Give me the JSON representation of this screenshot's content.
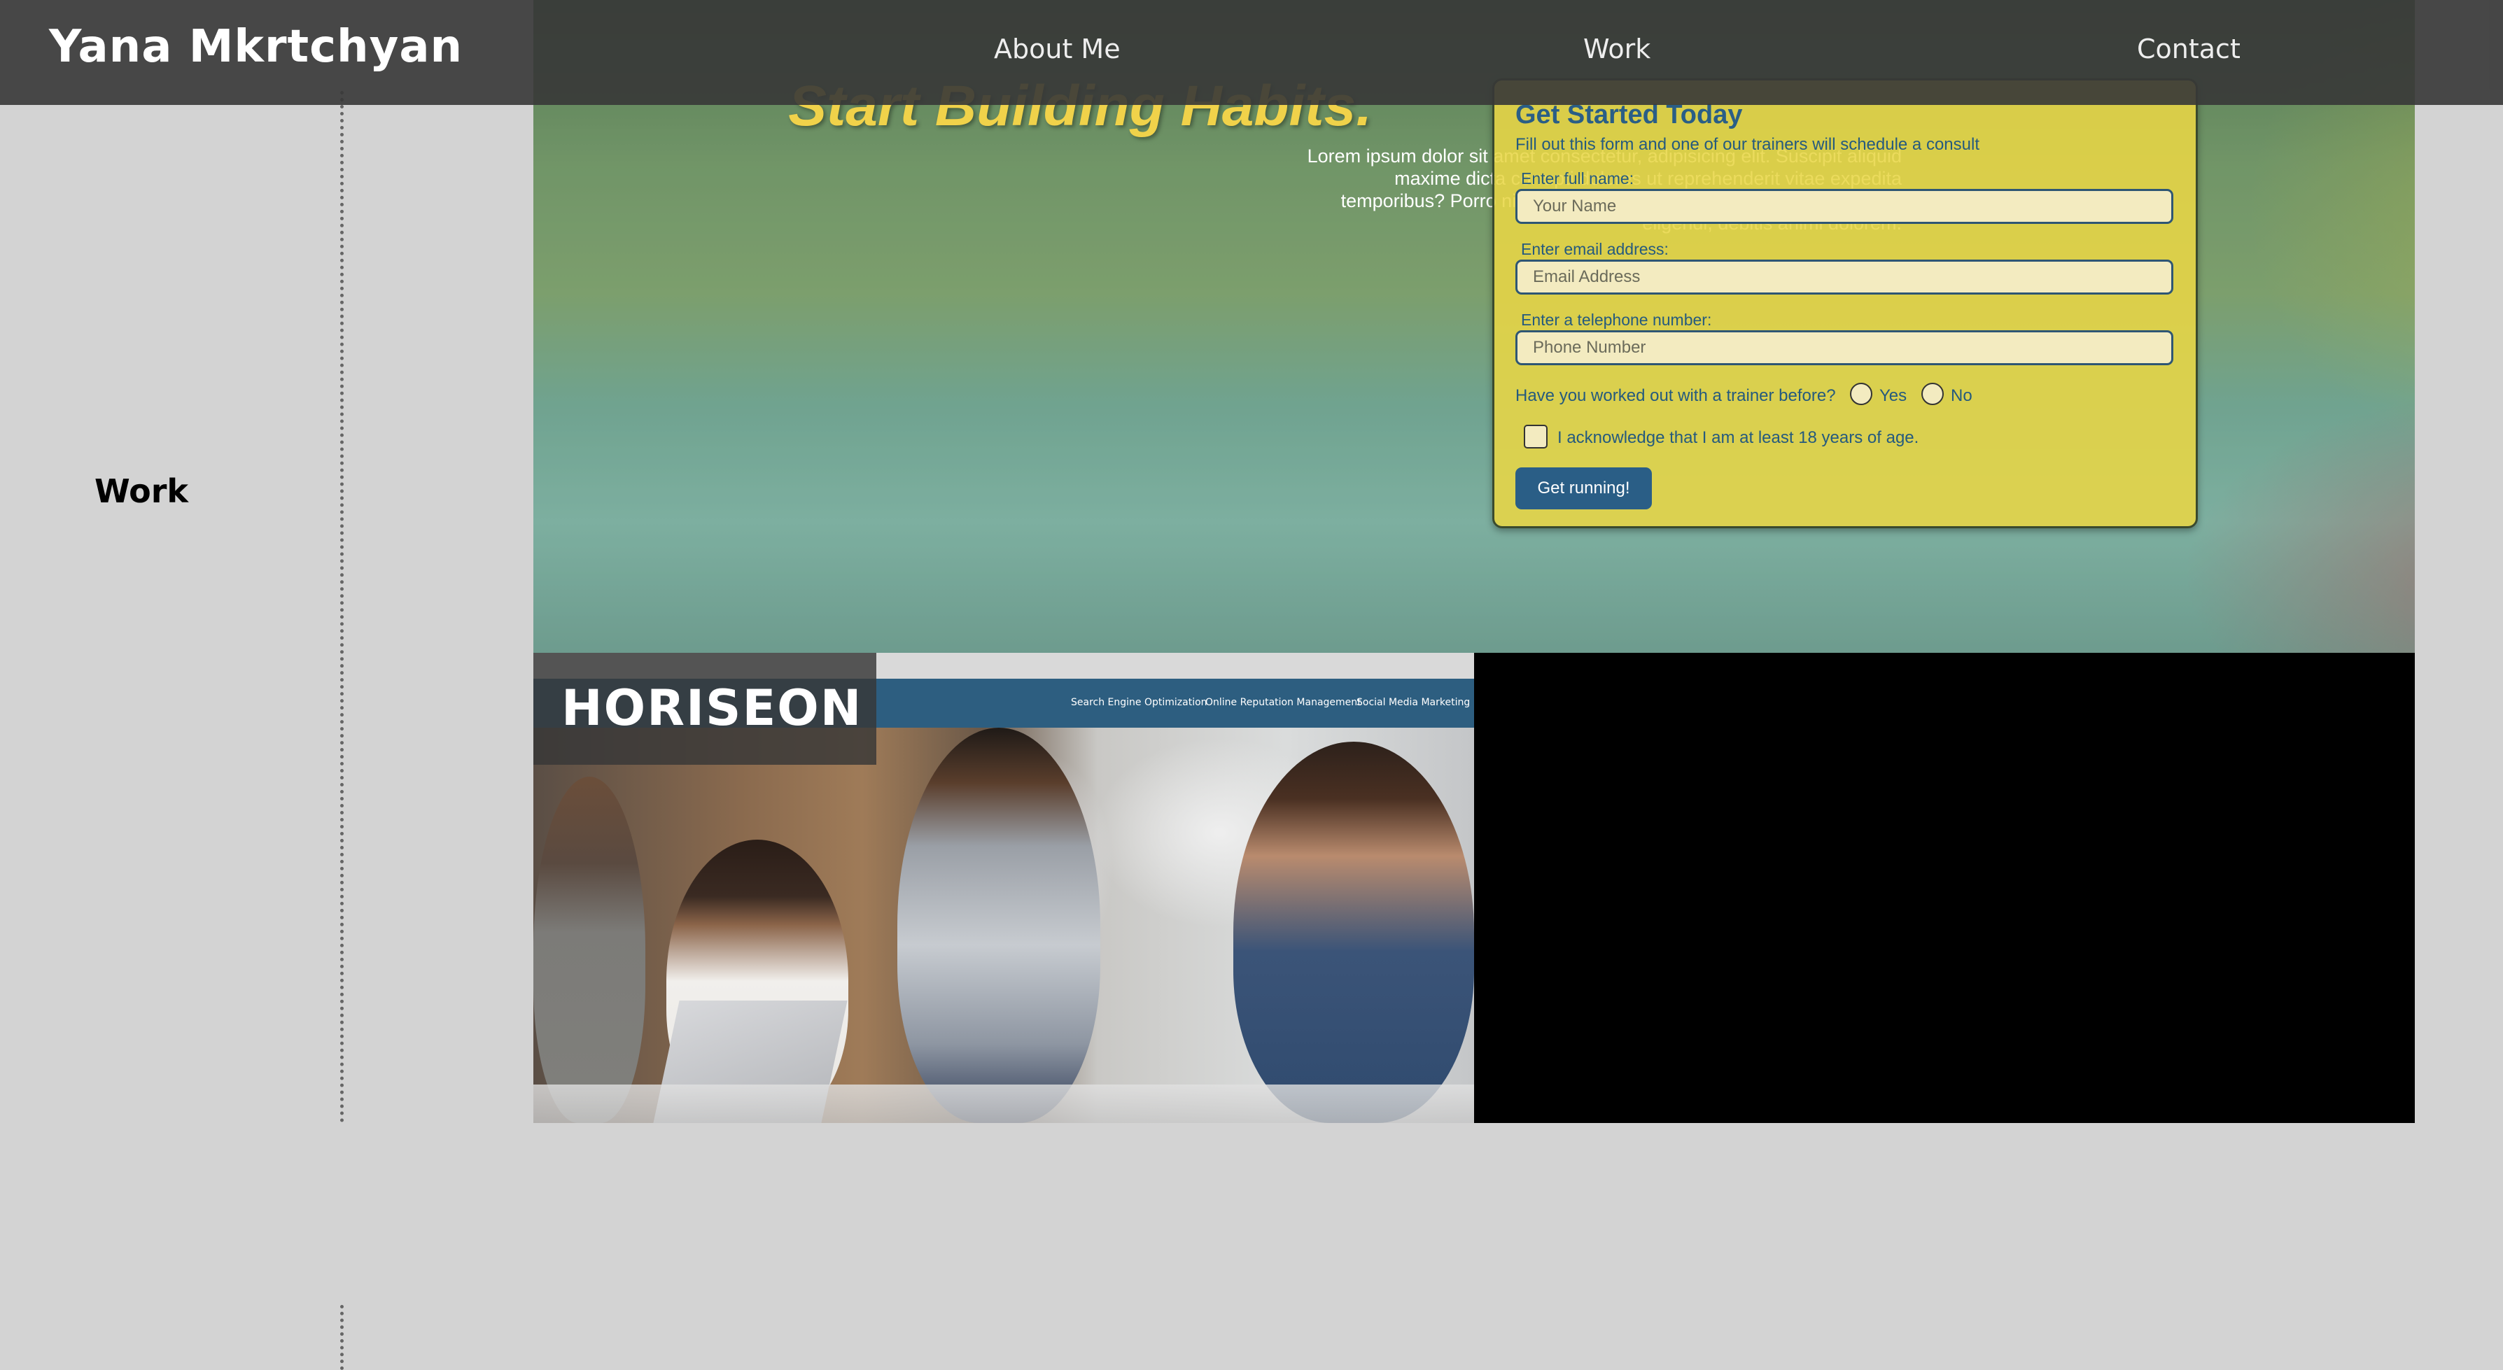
{
  "navbar": {
    "brand": "Yana Mkrtchyan",
    "links": [
      {
        "label": "About Me"
      },
      {
        "label": "Work"
      },
      {
        "label": "Contact"
      }
    ]
  },
  "section": {
    "title": "Work"
  },
  "projects": {
    "fitness": {
      "headline": "Start Building Habits.",
      "body_lines": [
        "Lorem ipsum dolor sit amet consectetur, adipisicing elit. Suscipit aliquid",
        "maxime dicta corrupti dolores ut reprehenderit vitae expedita",
        "temporibus? Porro nisi veniam nemo placeat pariatur reprehenderit",
        "eligendi, debitis animi dolorem."
      ],
      "form": {
        "title": "Get Started Today",
        "subtitle": "Fill out this form and one of our trainers will schedule a consult",
        "name_label": "Enter full name:",
        "name_placeholder": "Your Name",
        "email_label": "Enter email address:",
        "email_placeholder": "Email Address",
        "phone_label": "Enter a telephone number:",
        "phone_placeholder": "Phone Number",
        "trainer_question": "Have you worked out with a trainer before?",
        "yes_label": "Yes",
        "no_label": "No",
        "age_ack": "I acknowledge that I am at least 18 years of age.",
        "submit": "Get running!"
      }
    },
    "horiseon": {
      "logo": "HORISEON",
      "links": [
        "Search Engine Optimization",
        "Online Reputation Management",
        "Social Media Marketing"
      ]
    }
  }
}
